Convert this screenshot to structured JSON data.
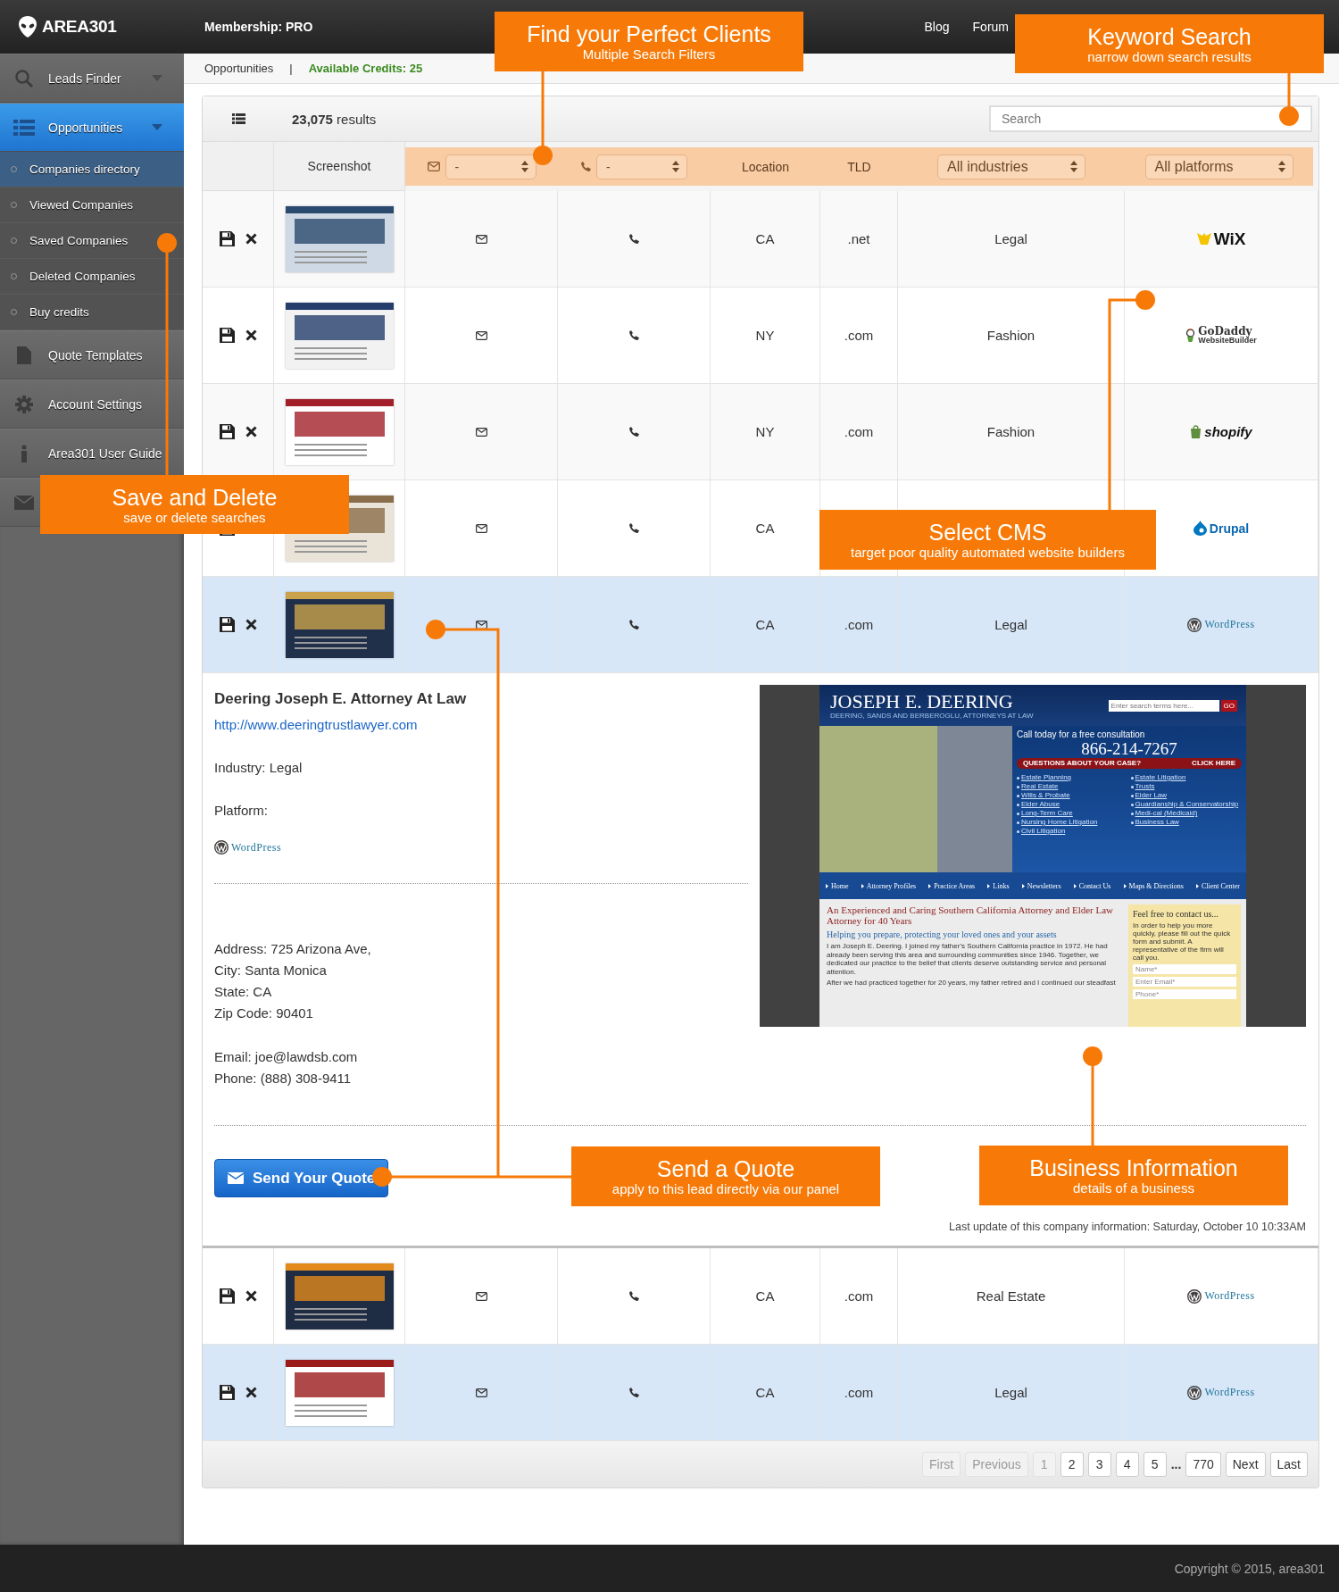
{
  "topbar": {
    "logo": "AREA301",
    "membership": "Membership: PRO",
    "nav": [
      {
        "label": "Blog"
      },
      {
        "label": "Forum"
      }
    ]
  },
  "sidebar": {
    "items": [
      {
        "label": "Leads Finder",
        "selected": false,
        "dropdown": true
      },
      {
        "label": "Opportunities",
        "selected": true,
        "dropdown": true,
        "children": [
          {
            "label": "Companies directory",
            "selected": true
          },
          {
            "label": "Viewed Companies",
            "selected": false
          },
          {
            "label": "Saved Companies",
            "selected": false
          },
          {
            "label": "Deleted Companies",
            "selected": false
          },
          {
            "label": "Buy credits",
            "selected": false
          }
        ]
      },
      {
        "label": "Quote Templates",
        "selected": false
      },
      {
        "label": "Account Settings",
        "selected": false
      },
      {
        "label": "Area301 User Guide",
        "selected": false
      },
      {
        "selected": false
      }
    ]
  },
  "breadcrumb": {
    "page": "Opportunities",
    "separator": "|",
    "credits": "Available Credits: 25"
  },
  "toolbar": {
    "results": "**23,075** results",
    "search": {
      "placeholder": "Search"
    }
  },
  "table": {
    "columns": [
      {
        "kind": "blank"
      },
      {
        "kind": "label",
        "label": "Screenshot"
      },
      {
        "kind": "select",
        "value": "-"
      },
      {
        "kind": "select",
        "value": "-"
      },
      {
        "kind": "label",
        "label": "Location"
      },
      {
        "kind": "label",
        "label": "TLD"
      },
      {
        "kind": "select",
        "value": "All industries"
      },
      {
        "kind": "select",
        "value": "All platforms"
      }
    ],
    "rows": [
      {
        "location": "CA",
        "tld": ".net",
        "industry": "Legal",
        "highlighted": false,
        "platform": {
          "kind": "wix",
          "name": "WiX"
        }
      },
      {
        "location": "NY",
        "tld": ".com",
        "industry": "Fashion",
        "highlighted": false,
        "platform": {
          "kind": "godaddy",
          "name": "GoDaddy",
          "tagline": "WebsiteBuilder"
        }
      },
      {
        "location": "NY",
        "tld": ".com",
        "industry": "Fashion",
        "highlighted": false,
        "platform": {
          "kind": "shopify",
          "name": "shopify"
        }
      },
      {
        "location": "CA",
        "highlighted": false,
        "platform": {
          "kind": "drupal",
          "name": "Drupal"
        }
      },
      {
        "location": "CA",
        "tld": ".com",
        "industry": "Legal",
        "highlighted": true,
        "platform": {
          "kind": "wordpress",
          "name": "WordPress"
        },
        "detail": {
          "name": "Deering Joseph E. Attorney At Law",
          "url": "http://www.deeringtrustlawyer.com",
          "industry": "Industry: Legal",
          "platform_label": "Platform:",
          "platform": {
            "kind": "wordpress",
            "name": "WordPress"
          },
          "address_lines": [
            "Address: 725 Arizona Ave,",
            "City: Santa Monica",
            "State: CA",
            "Zip Code: 90401"
          ],
          "contact_lines": [
            "Email: joe@lawdsb.com",
            "Phone: (888) 308-9411"
          ],
          "button": "Send Your Quote",
          "updated": "Last update of this company information: Saturday, October 10 10:33AM",
          "preview": {
            "site_title": "JOSEPH E. DEERING",
            "site_subtitle": "DEERING, SANDS AND BERBEROGLU, ATTORNEYS AT LAW",
            "search_placeholder": "Enter search terms here...",
            "search_button": "GO",
            "call_text": "Call today for a free consultation",
            "phone": "866-214-7267",
            "question": "QUESTIONS ABOUT YOUR CASE?",
            "click": "CLICK HERE",
            "links_left": [
              "Estate Planning",
              "Real Estate",
              "Wills & Probate",
              "Elder Abuse",
              "Long-Term Care",
              "Nursing Home Litigation",
              "Civil Litigation"
            ],
            "links_right": [
              "Estate Litigation",
              "Trusts",
              "Elder Law",
              "Guardianship & Conservatorship",
              "Medi-cal (Medicaid)",
              "Business Law"
            ],
            "nav": [
              "Home",
              "Attorney Profiles",
              "Practice Areas",
              "Links",
              "Newsletters",
              "Contact Us",
              "Maps & Directions",
              "Client Center"
            ],
            "headline": "An Experienced and Caring Southern California Attorney and Elder Law Attorney for 40 Years",
            "subheadline": "Helping you prepare, protecting your loved ones and your assets",
            "paragraphs": [
              "I am Joseph E. Deering. I joined my father's Southern California practice in 1972. He had already been serving this area and surrounding communities since 1946. Together, we dedicated our practice to the belief that clients deserve outstanding service and personal attention.",
              "After we had practiced together for 20 years, my father retired and I continued our steadfast"
            ],
            "contact_title": "Feel free to contact us...",
            "contact_text": "In order to help you more quickly, please fill out the quick form and submit. A representative of the firm will call you.",
            "fields": [
              "Name*",
              "Enter Email*",
              "Phone*"
            ]
          }
        }
      },
      {
        "location": "CA",
        "tld": ".com",
        "industry": "Real Estate",
        "highlighted": false,
        "platform": {
          "kind": "wordpress",
          "name": "WordPress"
        }
      },
      {
        "location": "CA",
        "tld": ".com",
        "industry": "Legal",
        "highlighted": true,
        "platform": {
          "kind": "wordpress",
          "name": "WordPress"
        }
      }
    ]
  },
  "pagination": [
    {
      "label": "First",
      "kind": "button",
      "disabled": true
    },
    {
      "label": "Previous",
      "kind": "button",
      "disabled": true
    },
    {
      "label": "1",
      "kind": "button",
      "disabled": true
    },
    {
      "label": "2",
      "kind": "button",
      "disabled": false
    },
    {
      "label": "3",
      "kind": "button",
      "disabled": false
    },
    {
      "label": "4",
      "kind": "button",
      "disabled": false
    },
    {
      "label": "5",
      "kind": "button",
      "disabled": false
    },
    {
      "label": "...",
      "kind": "ellipsis"
    },
    {
      "label": "770",
      "kind": "button",
      "disabled": false
    },
    {
      "label": "Next",
      "kind": "button",
      "disabled": false
    },
    {
      "label": "Last",
      "kind": "button",
      "disabled": false
    }
  ],
  "footer": {
    "copyright": "Copyright © 2015, area301"
  },
  "callouts": [
    {
      "title": "Find your Perfect Clients",
      "subtitle": "Multiple Search Filters"
    },
    {
      "title": "Keyword Search",
      "subtitle": "narrow down search results"
    },
    {
      "title": "Save and Delete",
      "subtitle": "save or delete searches"
    },
    {
      "title": "Select CMS",
      "subtitle": "target poor quality automated website builders"
    },
    {
      "title": "Send a Quote",
      "subtitle": "apply to this lead directly via our panel"
    },
    {
      "title": "Business Information",
      "subtitle": "details of a business"
    }
  ]
}
